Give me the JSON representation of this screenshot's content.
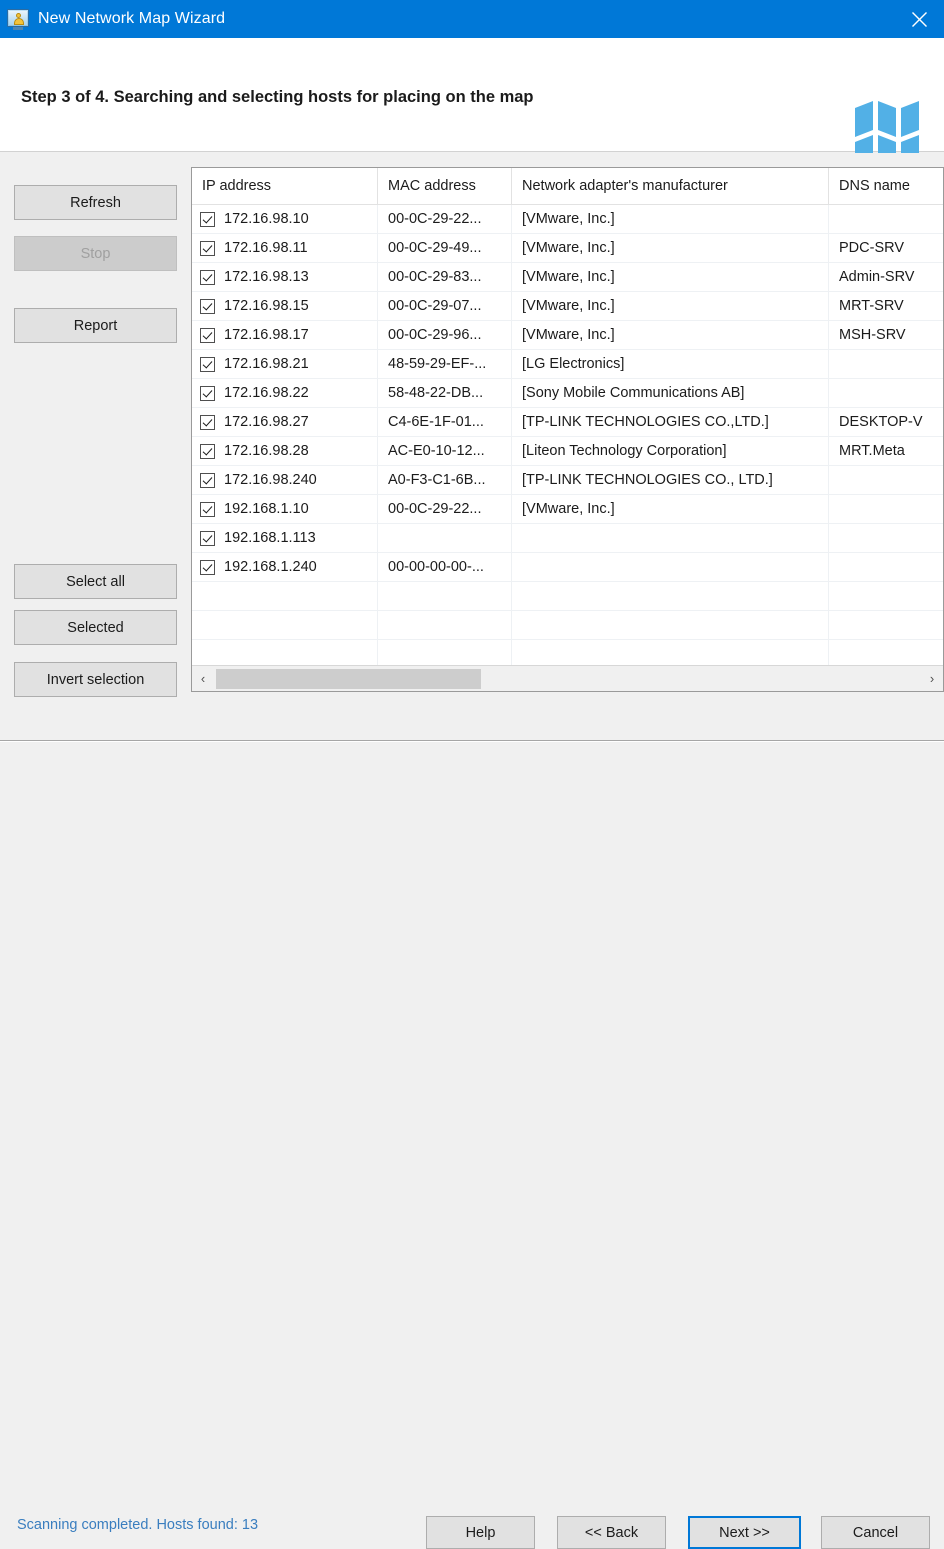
{
  "window": {
    "title": "New Network Map Wizard",
    "icon": "network-map-wizard-icon",
    "close_label": "✕",
    "accent_color": "#0078d7",
    "titlebar_color": "#0078d7"
  },
  "header": {
    "step_title": "Step 3 of 4. Searching and selecting hosts for placing on the map",
    "logo": "folded-map-icon",
    "logo_color": "#52b0e6"
  },
  "sidebar": {
    "buttons": [
      {
        "label": "Refresh",
        "name": "refresh-button",
        "disabled": false
      },
      {
        "label": "Stop",
        "name": "stop-button",
        "disabled": true
      },
      {
        "label": "Report",
        "name": "report-button",
        "disabled": false
      }
    ],
    "selection_buttons": [
      {
        "label": "Select all",
        "name": "select-all-button",
        "disabled": false
      },
      {
        "label": "Selected",
        "name": "selected-button",
        "disabled": false
      },
      {
        "label": "Invert selection",
        "name": "invert-selection-button",
        "disabled": false
      }
    ]
  },
  "table": {
    "columns": [
      "IP address",
      "MAC address",
      "Network adapter's manufacturer",
      "DNS name"
    ],
    "rows": [
      {
        "checked": true,
        "ip": "172.16.98.10",
        "mac": "00-0C-29-22...",
        "manufacturer": "[VMware, Inc.]",
        "dns": ""
      },
      {
        "checked": true,
        "ip": "172.16.98.11",
        "mac": "00-0C-29-49...",
        "manufacturer": "[VMware, Inc.]",
        "dns": "PDC-SRV"
      },
      {
        "checked": true,
        "ip": "172.16.98.13",
        "mac": "00-0C-29-83...",
        "manufacturer": "[VMware, Inc.]",
        "dns": "Admin-SRV"
      },
      {
        "checked": true,
        "ip": "172.16.98.15",
        "mac": "00-0C-29-07...",
        "manufacturer": "[VMware, Inc.]",
        "dns": "MRT-SRV"
      },
      {
        "checked": true,
        "ip": "172.16.98.17",
        "mac": "00-0C-29-96...",
        "manufacturer": "[VMware, Inc.]",
        "dns": "MSH-SRV"
      },
      {
        "checked": true,
        "ip": "172.16.98.21",
        "mac": "48-59-29-EF-...",
        "manufacturer": "[LG Electronics]",
        "dns": ""
      },
      {
        "checked": true,
        "ip": "172.16.98.22",
        "mac": "58-48-22-DB...",
        "manufacturer": "[Sony Mobile Communications AB]",
        "dns": ""
      },
      {
        "checked": true,
        "ip": "172.16.98.27",
        "mac": "C4-6E-1F-01...",
        "manufacturer": "[TP-LINK TECHNOLOGIES CO.,LTD.]",
        "dns": "DESKTOP-V"
      },
      {
        "checked": true,
        "ip": "172.16.98.28",
        "mac": "AC-E0-10-12...",
        "manufacturer": "[Liteon Technology Corporation]",
        "dns": "MRT.Meta"
      },
      {
        "checked": true,
        "ip": "172.16.98.240",
        "mac": "A0-F3-C1-6B...",
        "manufacturer": "[TP-LINK TECHNOLOGIES CO., LTD.]",
        "dns": ""
      },
      {
        "checked": true,
        "ip": "192.168.1.10",
        "mac": "00-0C-29-22...",
        "manufacturer": "[VMware, Inc.]",
        "dns": ""
      },
      {
        "checked": true,
        "ip": "192.168.1.113",
        "mac": "",
        "manufacturer": "",
        "dns": ""
      },
      {
        "checked": true,
        "ip": "192.168.1.240",
        "mac": "00-00-00-00-...",
        "manufacturer": "",
        "dns": ""
      },
      {
        "checked": false,
        "ip": "",
        "mac": "",
        "manufacturer": "",
        "dns": ""
      },
      {
        "checked": false,
        "ip": "",
        "mac": "",
        "manufacturer": "",
        "dns": ""
      },
      {
        "checked": false,
        "ip": "",
        "mac": "",
        "manufacturer": "",
        "dns": ""
      }
    ],
    "scrollbar": {
      "left_arrow": "‹",
      "right_arrow": "›"
    }
  },
  "footer": {
    "status": "Scanning completed. Hosts found: 13",
    "status_color": "#3a7ebf",
    "buttons": [
      {
        "label": "Help",
        "name": "help-button",
        "focused": false
      },
      {
        "label": "<< Back",
        "name": "back-button",
        "focused": false
      },
      {
        "label": "Next >>",
        "name": "next-button",
        "focused": true
      },
      {
        "label": "Cancel",
        "name": "cancel-button",
        "focused": false
      }
    ]
  }
}
